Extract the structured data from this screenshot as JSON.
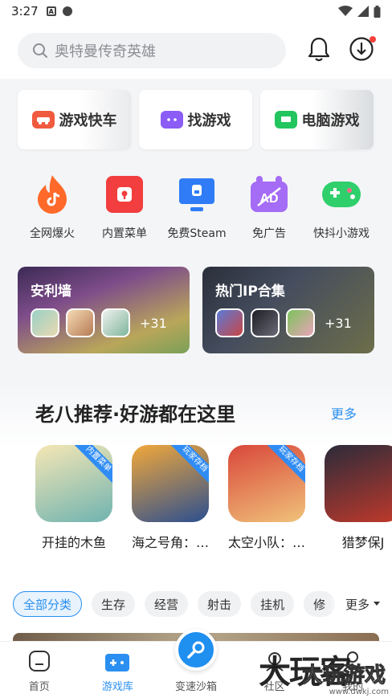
{
  "status_bar": {
    "time": "3:27",
    "notif_letter": "A"
  },
  "header": {
    "search_placeholder": "奥特曼传奇英雄"
  },
  "quick_cards": [
    {
      "label": "游戏快车",
      "icon": "car-icon",
      "color": "#f05a3e"
    },
    {
      "label": "找游戏",
      "icon": "gamepad-icon",
      "color": "#8b5cf6"
    },
    {
      "label": "电脑游戏",
      "icon": "monitor-icon",
      "color": "#22c55e"
    }
  ],
  "features": [
    {
      "label": "全网爆火",
      "icon": "flame-tiktok-icon",
      "color": "#ff6a2a"
    },
    {
      "label": "内置菜单",
      "icon": "menu-app-icon",
      "color": "#f23e3e"
    },
    {
      "label": "免费Steam",
      "icon": "steam-monitor-icon",
      "color": "#2f7cf6"
    },
    {
      "label": "免广告",
      "icon": "ad-block-icon",
      "color": "#a56cf5"
    },
    {
      "label": "快抖小游戏",
      "icon": "mini-game-icon",
      "color": "#2fcf6c"
    }
  ],
  "banners": [
    {
      "title": "安利墙",
      "extra": "+31"
    },
    {
      "title": "热门IP合集",
      "extra": "+31"
    }
  ],
  "recommend": {
    "title": "老八推荐·好游都在这里",
    "more": "更多",
    "items": [
      {
        "name": "开挂的木鱼",
        "ribbon": "内置菜单",
        "c1": "#f6e7b5",
        "c2": "#6fb3b0"
      },
      {
        "name": "海之号角：…",
        "ribbon": "玩家存档",
        "c1": "#f2a83a",
        "c2": "#2c4f8f"
      },
      {
        "name": "太空小队：…",
        "ribbon": "玩家存档",
        "c1": "#d9473a",
        "c2": "#f0c27a"
      },
      {
        "name": "猎梦保J",
        "ribbon": "",
        "c1": "#2b2b3a",
        "c2": "#c0392b"
      }
    ]
  },
  "tags": [
    "全部分类",
    "生存",
    "经营",
    "射击",
    "挂机",
    "修"
  ],
  "tags_more": "更多",
  "tabs": [
    {
      "label": "首页",
      "icon": "home-icon",
      "active": false
    },
    {
      "label": "游戏库",
      "icon": "game-library-icon",
      "active": true
    },
    {
      "label": "变速沙箱",
      "icon": "speed-sandbox-icon",
      "active": false
    },
    {
      "label": "社区",
      "icon": "community-icon",
      "active": false
    },
    {
      "label": "我的",
      "icon": "profile-icon",
      "active": false
    }
  ],
  "watermark": {
    "text": "大玩客",
    "sub": "大玩游戏",
    "url": "www.dwkj.com"
  },
  "colors": {
    "accent": "#2a8ff0",
    "badge": "#f5413d"
  }
}
